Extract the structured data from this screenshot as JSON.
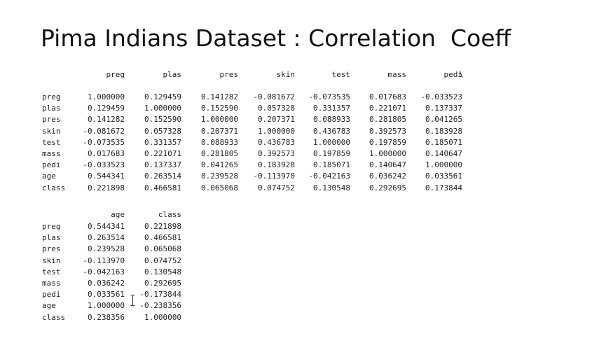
{
  "title": "Pima Indians Dataset : Correlation  Coeff",
  "table1": {
    "columns": [
      "preg",
      "plas",
      "pres",
      "skin",
      "test",
      "mass",
      "pedi"
    ],
    "continuation": "\\",
    "rows": [
      {
        "label": "preg",
        "values": [
          "1.000000",
          "0.129459",
          "0.141282",
          "-0.081672",
          "-0.073535",
          "0.017683",
          "-0.033523"
        ]
      },
      {
        "label": "plas",
        "values": [
          "0.129459",
          "1.000000",
          "0.152590",
          "0.057328",
          "0.331357",
          "0.221071",
          "0.137337"
        ]
      },
      {
        "label": "pres",
        "values": [
          "0.141282",
          "0.152590",
          "1.000000",
          "0.207371",
          "0.088933",
          "0.281805",
          "0.041265"
        ]
      },
      {
        "label": "skin",
        "values": [
          "-0.081672",
          "0.057328",
          "0.207371",
          "1.000000",
          "0.436783",
          "0.392573",
          "0.183928"
        ]
      },
      {
        "label": "test",
        "values": [
          "-0.073535",
          "0.331357",
          "0.088933",
          "0.436783",
          "1.000000",
          "0.197859",
          "0.185071"
        ]
      },
      {
        "label": "mass",
        "values": [
          "0.017683",
          "0.221071",
          "0.281805",
          "0.392573",
          "0.197859",
          "1.000000",
          "0.140647"
        ]
      },
      {
        "label": "pedi",
        "values": [
          "-0.033523",
          "0.137337",
          "0.041265",
          "0.183928",
          "0.185071",
          "0.140647",
          "1.000000"
        ]
      },
      {
        "label": "age",
        "values": [
          "0.544341",
          "0.263514",
          "0.239528",
          "-0.113970",
          "-0.042163",
          "0.036242",
          "0.033561"
        ]
      },
      {
        "label": "class",
        "values": [
          "0.221898",
          "0.466581",
          "0.065068",
          "0.074752",
          "0.130548",
          "0.292695",
          "0.173844"
        ]
      }
    ]
  },
  "table2": {
    "columns": [
      "age",
      "class"
    ],
    "rows": [
      {
        "label": "preg",
        "values": [
          "0.544341",
          "0.221898"
        ]
      },
      {
        "label": "plas",
        "values": [
          "0.263514",
          "0.466581"
        ]
      },
      {
        "label": "pres",
        "values": [
          "0.239528",
          "0.065068"
        ]
      },
      {
        "label": "skin",
        "values": [
          "-0.113970",
          "0.074752"
        ]
      },
      {
        "label": "test",
        "values": [
          "-0.042163",
          "0.130548"
        ]
      },
      {
        "label": "mass",
        "values": [
          "0.036242",
          "0.292695"
        ]
      },
      {
        "label": "pedi",
        "values": [
          "0.033561",
          "-0.173844"
        ]
      },
      {
        "label": "age",
        "values": [
          "1.000000",
          "-0.238356"
        ]
      },
      {
        "label": "class",
        "values": [
          "0.238356",
          "1.000000"
        ]
      }
    ]
  },
  "cursor_icon": "text-cursor-icon"
}
